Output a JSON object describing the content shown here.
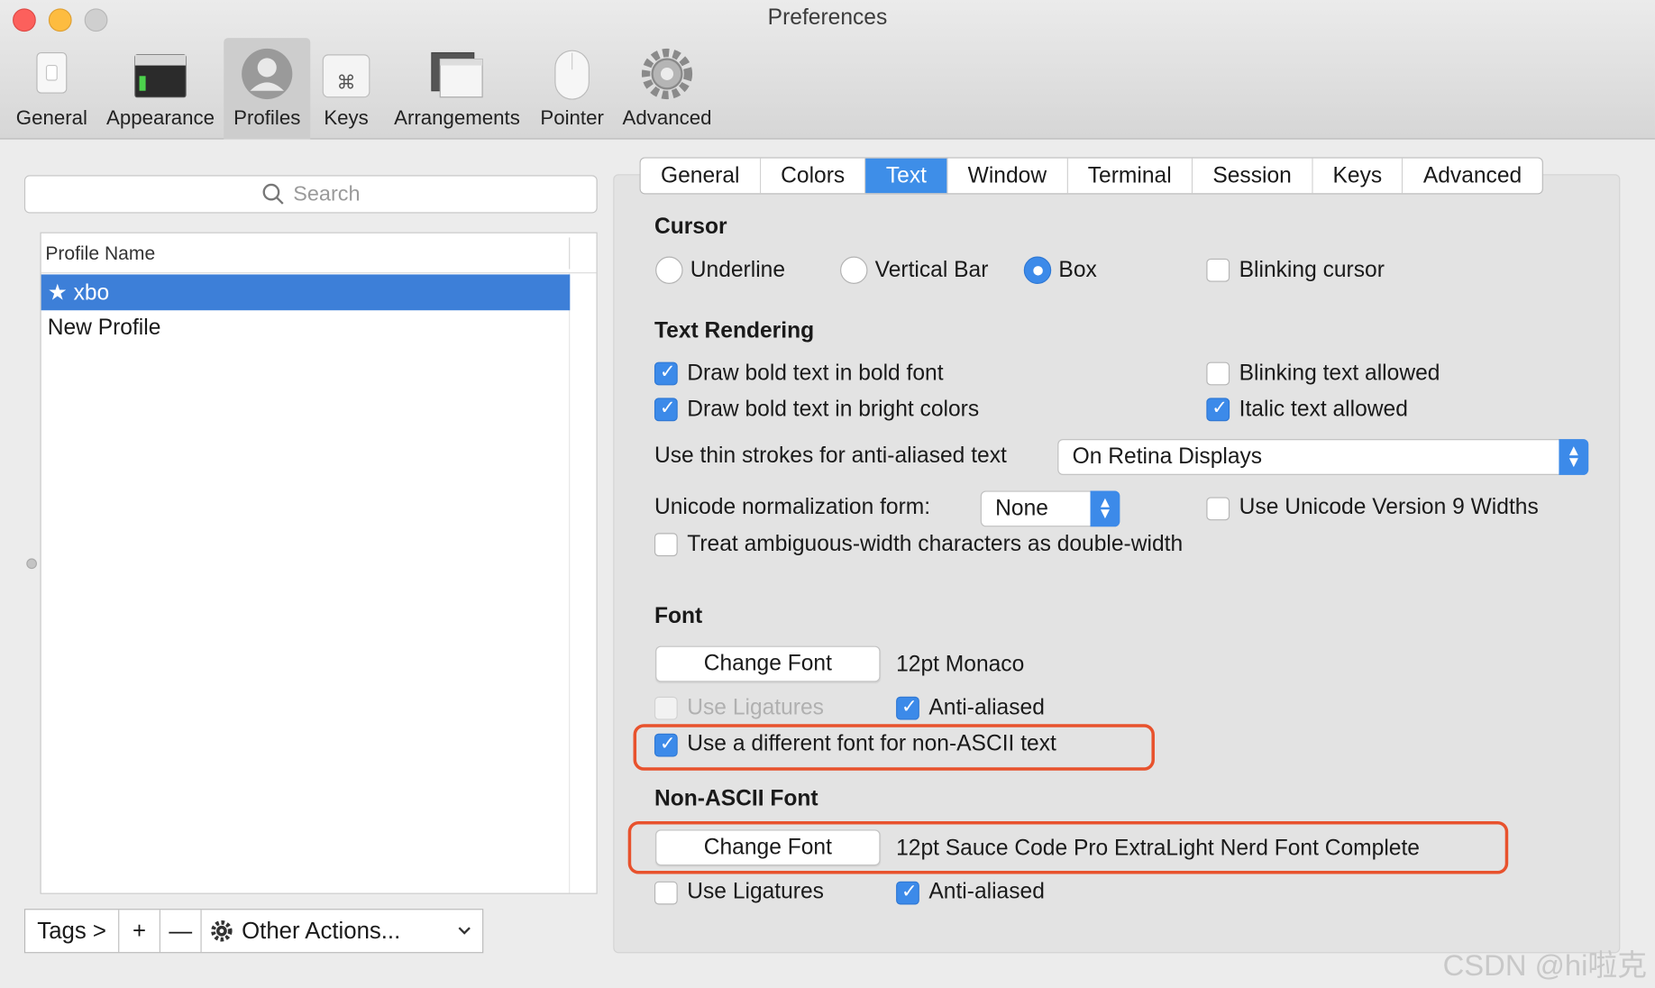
{
  "window": {
    "title": "Preferences"
  },
  "toolbar": {
    "items": [
      {
        "label": "General",
        "icon": "general-switch-icon"
      },
      {
        "label": "Appearance",
        "icon": "appearance-terminal-icon"
      },
      {
        "label": "Profiles",
        "icon": "profiles-person-icon"
      },
      {
        "label": "Keys",
        "icon": "keys-command-icon"
      },
      {
        "label": "Arrangements",
        "icon": "arrangements-windows-icon"
      },
      {
        "label": "Pointer",
        "icon": "pointer-mouse-icon"
      },
      {
        "label": "Advanced",
        "icon": "advanced-gear-icon"
      }
    ],
    "selected": "Profiles"
  },
  "sidebar": {
    "search_placeholder": "Search",
    "column_header": "Profile Name",
    "profiles": [
      {
        "name": "★ xbo",
        "selected": true
      },
      {
        "name": "New Profile",
        "selected": false
      }
    ],
    "bottom": {
      "tags": "Tags >",
      "add": "+",
      "remove": "—",
      "other_actions": "Other Actions..."
    }
  },
  "tabs": [
    {
      "label": "General"
    },
    {
      "label": "Colors"
    },
    {
      "label": "Text",
      "active": true
    },
    {
      "label": "Window"
    },
    {
      "label": "Terminal"
    },
    {
      "label": "Session"
    },
    {
      "label": "Keys"
    },
    {
      "label": "Advanced"
    }
  ],
  "cursor": {
    "title": "Cursor",
    "options": [
      "Underline",
      "Vertical Bar",
      "Box"
    ],
    "selected": "Box",
    "blinking_label": "Blinking cursor",
    "blinking": false
  },
  "text_rendering": {
    "title": "Text Rendering",
    "bold_font": {
      "label": "Draw bold text in bold font",
      "checked": true
    },
    "bright_colors": {
      "label": "Draw bold text in bright colors",
      "checked": true
    },
    "blinking_allowed": {
      "label": "Blinking text allowed",
      "checked": false
    },
    "italic_allowed": {
      "label": "Italic text allowed",
      "checked": true
    },
    "thin_strokes_label": "Use thin strokes for anti-aliased text",
    "thin_strokes_value": "On Retina Displays",
    "unicode_norm_label": "Unicode normalization form:",
    "unicode_norm_value": "None",
    "unicode_v9": {
      "label": "Use Unicode Version 9 Widths",
      "checked": false
    },
    "ambiguous_width": {
      "label": "Treat ambiguous-width characters as double-width",
      "checked": false
    }
  },
  "font": {
    "title": "Font",
    "change_button": "Change Font",
    "current": "12pt Monaco",
    "ligatures": {
      "label": "Use Ligatures",
      "checked": false,
      "disabled": true
    },
    "anti_aliased": {
      "label": "Anti-aliased",
      "checked": true
    },
    "different_non_ascii": {
      "label": "Use a different font for non-ASCII text",
      "checked": true
    }
  },
  "non_ascii_font": {
    "title": "Non-ASCII Font",
    "change_button": "Change Font",
    "current": "12pt Sauce Code Pro ExtraLight Nerd Font Complete",
    "ligatures": {
      "label": "Use Ligatures",
      "checked": false
    },
    "anti_aliased": {
      "label": "Anti-aliased",
      "checked": true
    }
  },
  "colors": {
    "accent": "#3c8ae9",
    "selection": "#3d7fd8",
    "highlight_box": "#e8522d"
  },
  "watermark": "CSDN @hi啦克"
}
